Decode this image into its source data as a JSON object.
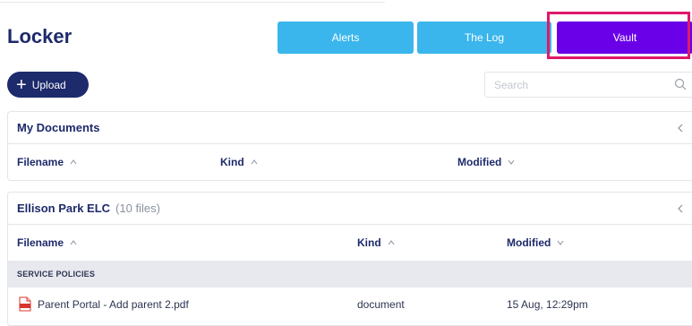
{
  "page": {
    "title": "Locker"
  },
  "tabs": [
    {
      "label": "Alerts"
    },
    {
      "label": "The Log"
    },
    {
      "label": "Vault",
      "active": true
    }
  ],
  "toolbar": {
    "upload_label": "Upload",
    "search_placeholder": "Search"
  },
  "my_documents": {
    "title": "My Documents",
    "columns": [
      {
        "label": "Filename"
      },
      {
        "label": "Kind"
      },
      {
        "label": "Modified"
      }
    ]
  },
  "ellison": {
    "title": "Ellison Park ELC",
    "file_count": "(10 files)",
    "columns": [
      {
        "label": "Filename"
      },
      {
        "label": "Kind"
      },
      {
        "label": "Modified"
      }
    ],
    "section": "SERVICE POLICIES",
    "files": [
      {
        "name": "Parent Portal - Add parent 2.pdf",
        "kind": "document",
        "modified": "15 Aug, 12:29pm",
        "icon": "pdf-icon"
      }
    ]
  },
  "colors": {
    "brand": "#1d2a6b",
    "tab": "#3bb6ec",
    "tab_active": "#6a00e8",
    "highlight": "#e0186a"
  }
}
